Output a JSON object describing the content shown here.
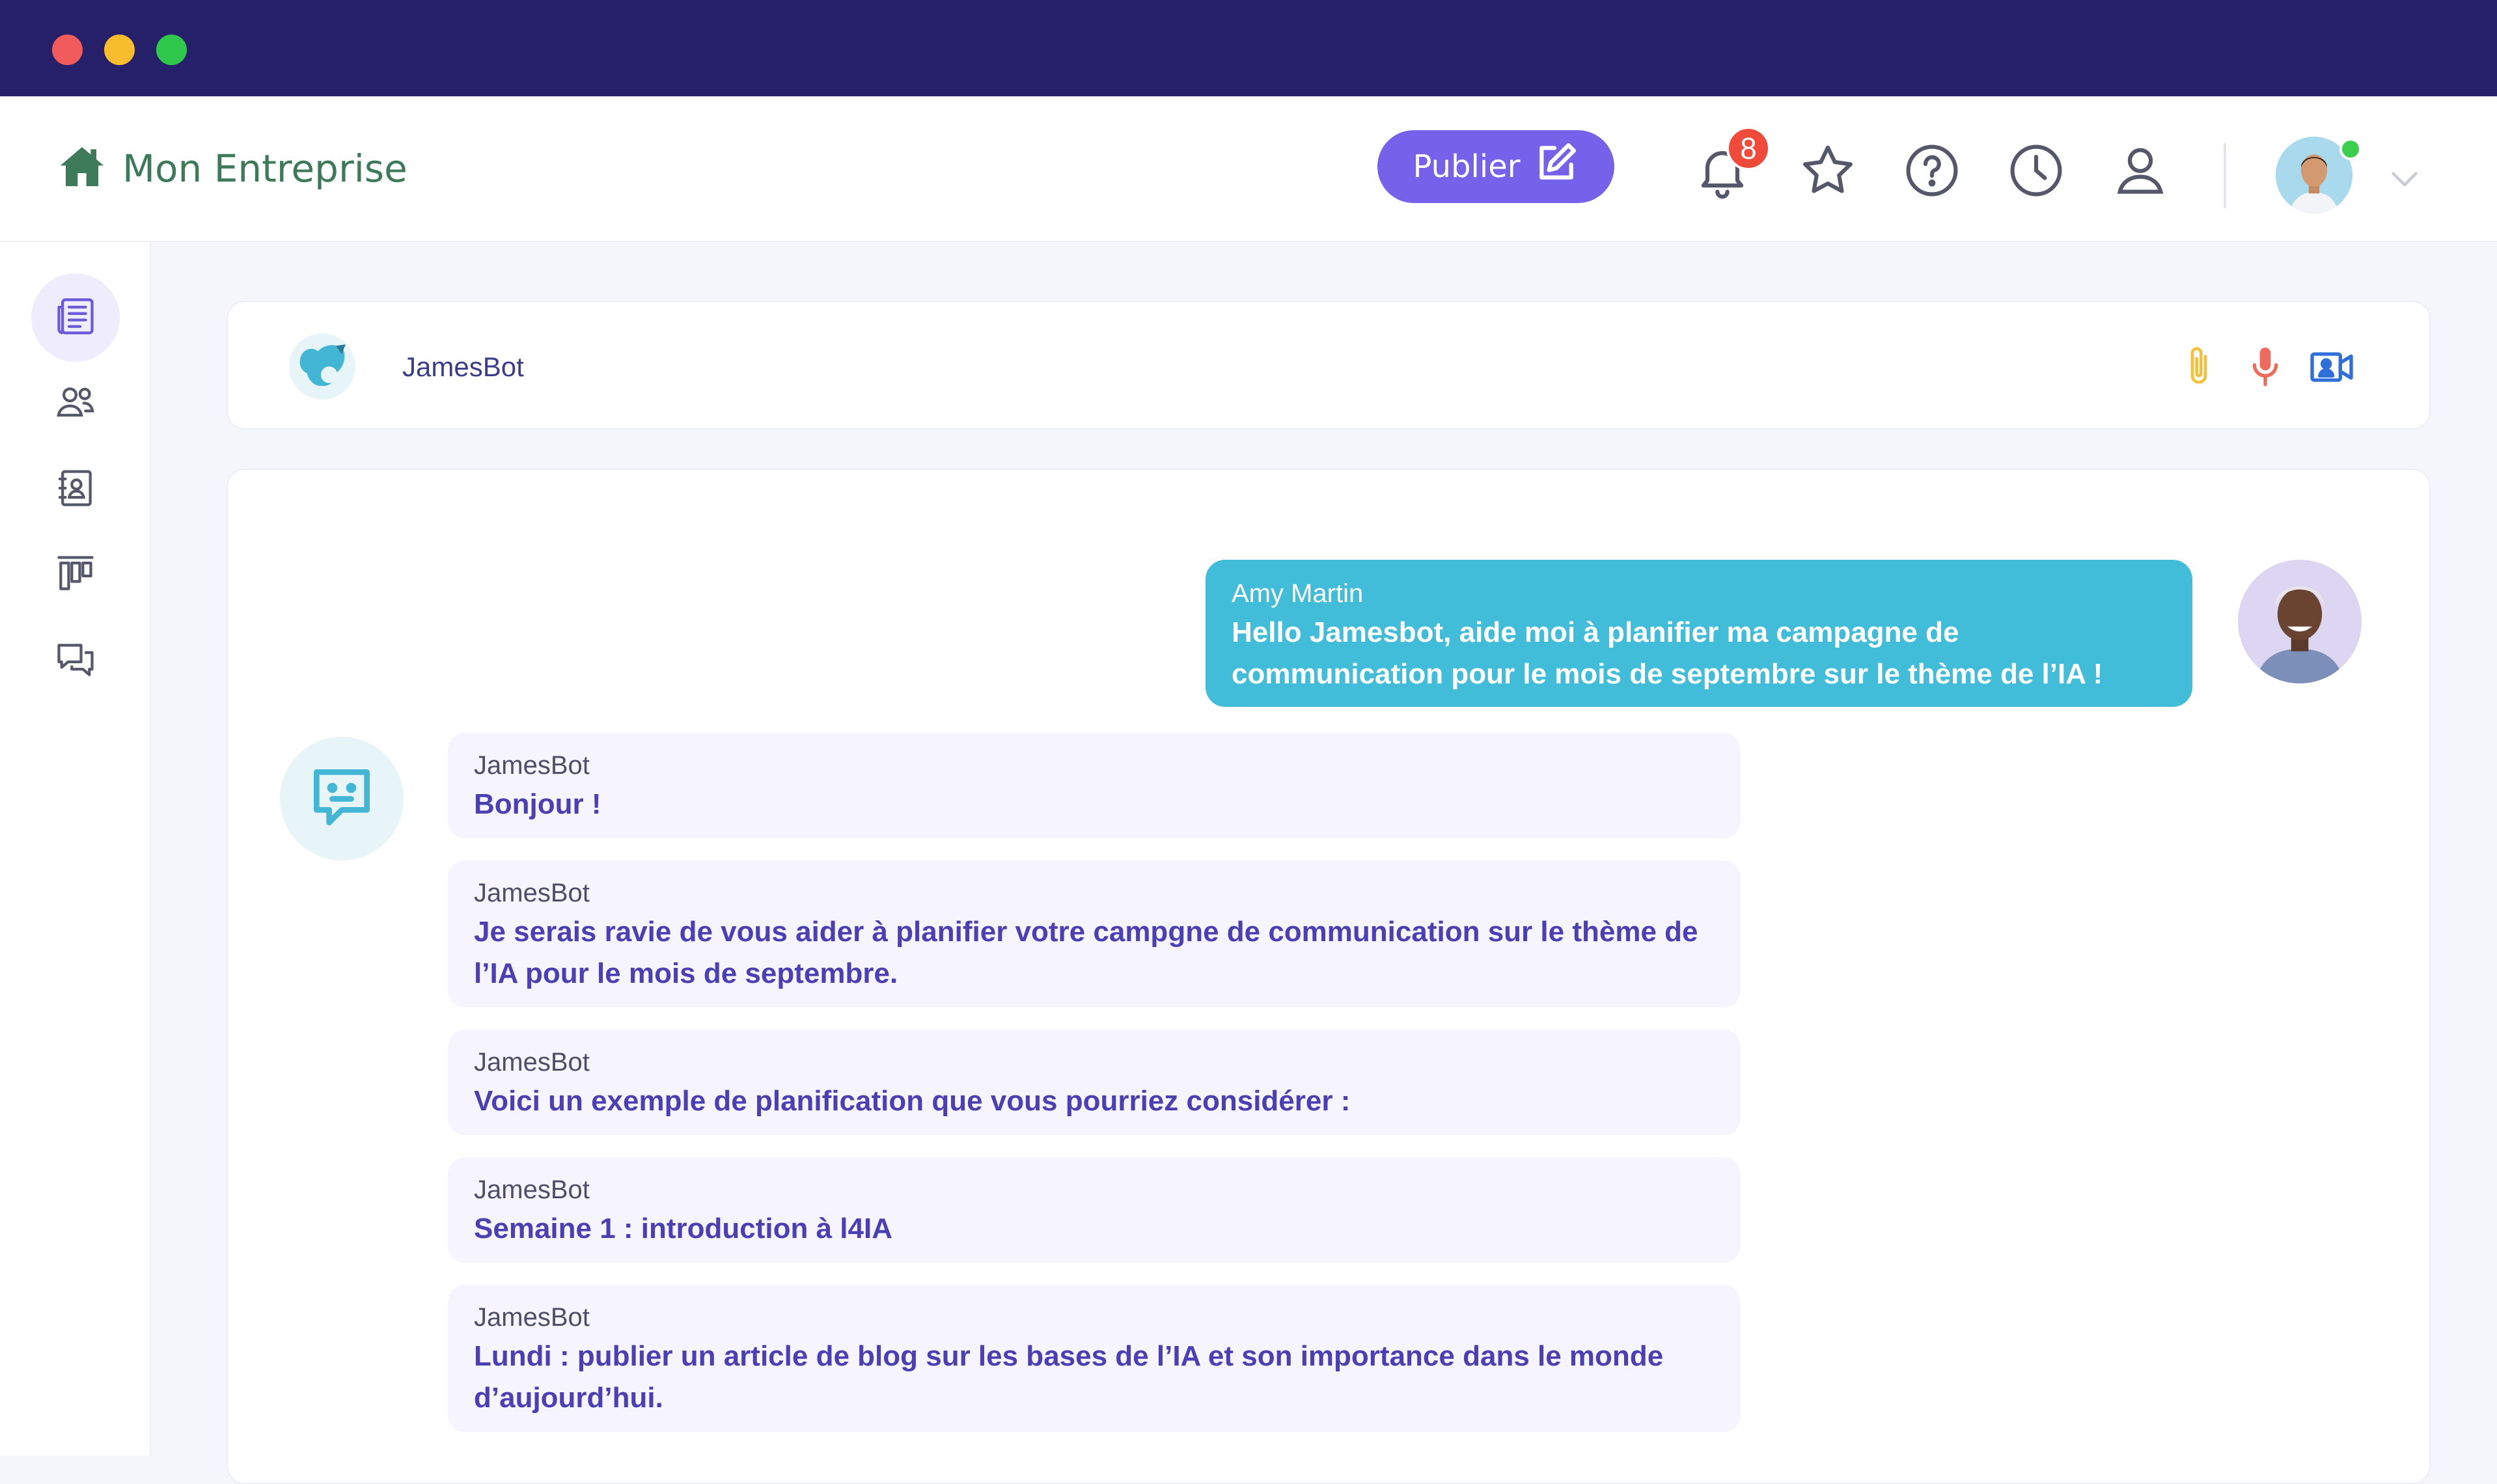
{
  "header": {
    "brand": "Mon Entreprise",
    "publish_label": "Publier",
    "notification_count": "8",
    "icons": [
      "home-icon",
      "edit-icon",
      "bell-icon",
      "star-icon",
      "help-icon",
      "clock-icon",
      "user-icon",
      "chevron-down-icon"
    ]
  },
  "sidebar": {
    "items": [
      "news-icon",
      "users-icon",
      "contacts-icon",
      "board-icon",
      "chat-icon"
    ]
  },
  "chat": {
    "title": "JamesBot",
    "actions": [
      "paperclip-icon",
      "microphone-icon",
      "video-icon"
    ],
    "messages": [
      {
        "author": "Amy Martin",
        "text": "Hello Jamesbot, aide moi à planifier ma campagne de communication pour le mois de septembre sur le thème de l’IA !"
      },
      {
        "author": "JamesBot",
        "text": "Bonjour !"
      },
      {
        "author": "JamesBot",
        "text": "Je serais ravie de vous aider à planifier votre campgne de communication sur le thème de l’IA pour le mois de septembre."
      },
      {
        "author": "JamesBot",
        "text": "Voici un exemple de planification que vous pourriez considérer :"
      },
      {
        "author": "JamesBot",
        "text": "Semaine 1 : introduction à l4IA"
      },
      {
        "author": "JamesBot",
        "text": "Lundi : publier un article de blog sur les bases de l’IA et son importance dans le monde d’aujourd’hui."
      }
    ]
  },
  "colors": {
    "titlebar": "#252069",
    "accent": "#7561ea",
    "user_bubble": "#41bcd9",
    "bot_bubble": "#f6f4fe",
    "bot_text": "#4b3fb5",
    "brand_green": "#3d7a5a"
  }
}
